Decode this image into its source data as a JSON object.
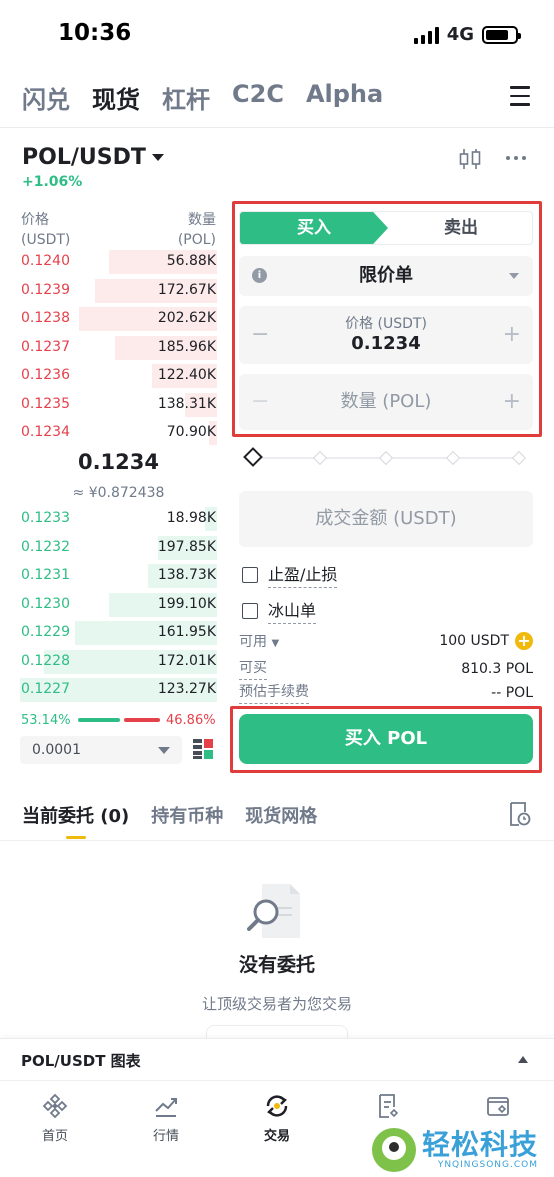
{
  "status_bar": {
    "time": "10:36",
    "network": "4G"
  },
  "top_tabs": [
    "闪兑",
    "现货",
    "杠杆",
    "C2C",
    "Alpha"
  ],
  "top_tabs_active": 1,
  "pair": {
    "symbol": "POL/USDT",
    "change": "+1.06%"
  },
  "orderbook": {
    "price_header": "价格",
    "price_unit": "(USDT)",
    "qty_header": "数量",
    "qty_unit": "(POL)",
    "asks": [
      {
        "price": "0.1240",
        "qty": "56.88K",
        "depth": 0.55
      },
      {
        "price": "0.1239",
        "qty": "172.67K",
        "depth": 0.62
      },
      {
        "price": "0.1238",
        "qty": "202.62K",
        "depth": 0.7
      },
      {
        "price": "0.1237",
        "qty": "185.96K",
        "depth": 0.52
      },
      {
        "price": "0.1236",
        "qty": "122.40K",
        "depth": 0.33
      },
      {
        "price": "0.1235",
        "qty": "138.31K",
        "depth": 0.16
      },
      {
        "price": "0.1234",
        "qty": "70.90K",
        "depth": 0.04
      }
    ],
    "last_price": "0.1234",
    "last_fiat": "≈ ¥0.872438",
    "bids": [
      {
        "price": "0.1233",
        "qty": "18.98K",
        "depth": 0.06
      },
      {
        "price": "0.1232",
        "qty": "197.85K",
        "depth": 0.3
      },
      {
        "price": "0.1231",
        "qty": "138.73K",
        "depth": 0.35
      },
      {
        "price": "0.1230",
        "qty": "199.10K",
        "depth": 0.55
      },
      {
        "price": "0.1229",
        "qty": "161.95K",
        "depth": 0.72
      },
      {
        "price": "0.1228",
        "qty": "172.01K",
        "depth": 0.88
      },
      {
        "price": "0.1227",
        "qty": "123.27K",
        "depth": 1.0
      }
    ],
    "buy_ratio": "53.14%",
    "sell_ratio": "46.86%",
    "precision": "0.0001"
  },
  "order_form": {
    "buy_tab": "买入",
    "sell_tab": "卖出",
    "order_type": "限价单",
    "price_label": "价格 (USDT)",
    "price_value": "0.1234",
    "qty_placeholder": "数量 (POL)",
    "total_placeholder": "成交金额 (USDT)",
    "tp_sl": "止盈/止损",
    "iceberg": "冰山单",
    "available_label": "可用",
    "available_value": "100 USDT",
    "can_buy_label": "可买",
    "can_buy_value": "810.3 POL",
    "fee_label": "预估手续费",
    "fee_value": "-- POL",
    "buy_button": "买入 POL"
  },
  "orders_tabs": [
    "当前委托 (0)",
    "持有币种",
    "现货网格"
  ],
  "empty": {
    "title": "没有委托",
    "subtitle": "让顶级交易者为您交易"
  },
  "chart_bar": "POL/USDT 图表",
  "nav": [
    "首页",
    "行情",
    "交易",
    "",
    ""
  ],
  "watermark": {
    "name": "轻松科技",
    "domain": "YNQINGSONG.COM"
  },
  "colors": {
    "green": "#2ebd85",
    "red": "#e5414b",
    "yellow": "#f0b90b"
  }
}
